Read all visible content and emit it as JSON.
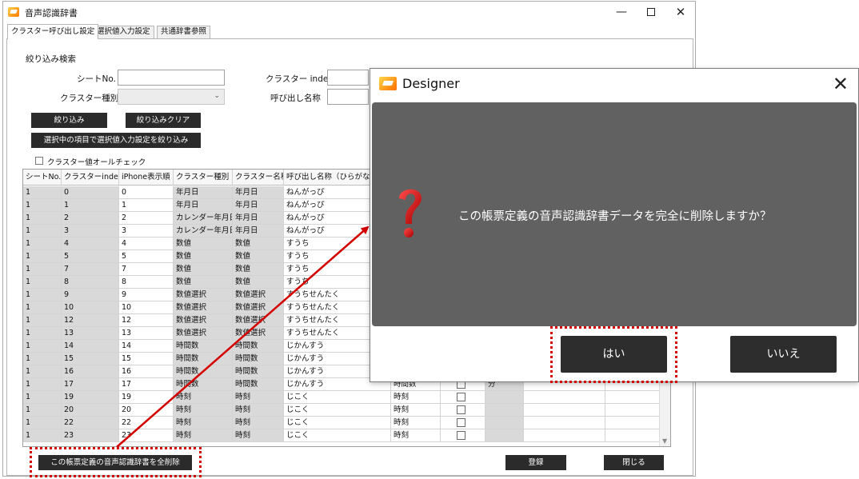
{
  "window": {
    "title": "音声認識辞書",
    "controls": {
      "minimize": "—",
      "close": "✕"
    }
  },
  "tabs": [
    {
      "label": "クラスター呼び出し設定",
      "active": true
    },
    {
      "label": "選択値入力設定",
      "active": false
    },
    {
      "label": "共通辞書参照",
      "active": false
    }
  ],
  "filter": {
    "section_title": "絞り込み検索",
    "sheet_no_label": "シートNo.",
    "cluster_index_label": "クラスター index",
    "cluster_type_label": "クラスター種別",
    "call_name_label": "呼び出し名称",
    "combo_arrow": "⌄"
  },
  "buttons": {
    "filter": "絞り込み",
    "filter_clear": "絞り込みクリア",
    "filter_by_selection": "選択中の項目で選択値入力設定を絞り込み",
    "delete_all": "この帳票定義の音声認識辞書を全削除",
    "register": "登録",
    "close": "閉じる"
  },
  "check_all_label": "クラスター値オールチェック",
  "grid": {
    "headers": [
      "シートNo.",
      "クラスターindex",
      "iPhone表示順",
      "クラスター種別",
      "クラスター名称",
      "呼び出し名称（ひらがな"
    ],
    "rows": [
      [
        "1",
        "0",
        "0",
        "年月日",
        "年月日",
        "ねんがっぴ"
      ],
      [
        "1",
        "1",
        "1",
        "年月日",
        "年月日",
        "ねんがっぴ"
      ],
      [
        "1",
        "2",
        "2",
        "カレンダー年月日",
        "年月日",
        "ねんがっぴ"
      ],
      [
        "1",
        "3",
        "3",
        "カレンダー年月日",
        "年月日",
        "ねんがっぴ"
      ],
      [
        "1",
        "4",
        "4",
        "数値",
        "数値",
        "すうち"
      ],
      [
        "1",
        "5",
        "5",
        "数値",
        "数値",
        "すうち"
      ],
      [
        "1",
        "7",
        "7",
        "数値",
        "数値",
        "すうち"
      ],
      [
        "1",
        "8",
        "8",
        "数値",
        "数値",
        "すうち"
      ],
      [
        "1",
        "9",
        "9",
        "数値選択",
        "数値選択",
        "すうちせんたく"
      ],
      [
        "1",
        "10",
        "10",
        "数値選択",
        "数値選択",
        "すうちせんたく"
      ],
      [
        "1",
        "12",
        "12",
        "数値選択",
        "数値選択",
        "すうちせんたく"
      ],
      [
        "1",
        "13",
        "13",
        "数値選択",
        "数値選択",
        "すうちせんたく"
      ],
      [
        "1",
        "14",
        "14",
        "時間数",
        "時間数",
        "じかんすう"
      ],
      [
        "1",
        "15",
        "15",
        "時間数",
        "時間数",
        "じかんすう"
      ],
      [
        "1",
        "16",
        "16",
        "時間数",
        "時間数",
        "じかんすう"
      ],
      [
        "1",
        "17",
        "17",
        "時間数",
        "時間数",
        "じかんすう"
      ],
      [
        "1",
        "19",
        "19",
        "時刻",
        "時刻",
        "じこく"
      ],
      [
        "1",
        "20",
        "20",
        "時刻",
        "時刻",
        "じこく"
      ],
      [
        "1",
        "22",
        "22",
        "時刻",
        "時刻",
        "じこく"
      ],
      [
        "1",
        "23",
        "23",
        "時刻",
        "時刻",
        "じこく"
      ]
    ],
    "extra_rows": [
      {
        "row": 15,
        "col7": "時間数",
        "col9": "分"
      },
      {
        "row": 16,
        "col7": "時刻",
        "col9": ""
      },
      {
        "row": 17,
        "col7": "時刻",
        "col9": ""
      },
      {
        "row": 18,
        "col7": "時刻",
        "col9": ""
      },
      {
        "row": 19,
        "col7": "時刻",
        "col9": ""
      }
    ]
  },
  "dialog": {
    "title": "Designer",
    "close": "✕",
    "message": "この帳票定義の音声認識辞書データを完全に削除しますか？",
    "yes": "はい",
    "no": "いいえ"
  },
  "colors": {
    "annotation_red": "#d40000",
    "dialog_panel": "#616161",
    "dark_button": "#2b2b2b"
  }
}
